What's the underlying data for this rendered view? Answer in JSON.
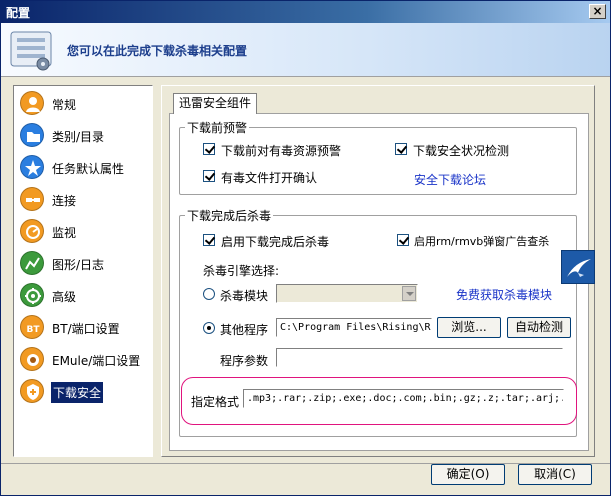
{
  "window": {
    "title": "配置",
    "close_label": "×"
  },
  "banner": {
    "text": "您可以在此完成下载杀毒相关配置"
  },
  "sidebar": {
    "items": [
      {
        "label": "常规",
        "icon": "person-icon",
        "color": "#f29a22"
      },
      {
        "label": "类别/目录",
        "icon": "folder-icon",
        "color": "#2a7ee0"
      },
      {
        "label": "任务默认属性",
        "icon": "star-icon",
        "color": "#2a7ee0"
      },
      {
        "label": "连接",
        "icon": "connection-icon",
        "color": "#f29a22"
      },
      {
        "label": "监视",
        "icon": "monitor-icon",
        "color": "#f29a22"
      },
      {
        "label": "图形/日志",
        "icon": "graph-icon",
        "color": "#3c9a3c"
      },
      {
        "label": "高级",
        "icon": "gear-icon",
        "color": "#3c9a3c"
      },
      {
        "label": "BT/端口设置",
        "icon": "bt-icon",
        "color": "#f29a22"
      },
      {
        "label": "EMule/端口设置",
        "icon": "emule-icon",
        "color": "#f29a22"
      },
      {
        "label": "下载安全",
        "icon": "shield-plus-icon",
        "color": "#f29a22"
      }
    ],
    "selected_index": 9
  },
  "tab": {
    "label": "迅雷安全组件"
  },
  "pre_download": {
    "legend": "下载前预警",
    "warn_toxic_label": "下载前对有毒资源预警",
    "warn_toxic_checked": true,
    "security_check_label": "下载安全状况检测",
    "security_check_checked": true,
    "confirm_open_label": "有毒文件打开确认",
    "confirm_open_checked": true,
    "forum_link": "安全下载论坛"
  },
  "post_download": {
    "legend": "下载完成后杀毒",
    "enable_scan_label": "启用下载完成后杀毒",
    "enable_scan_checked": true,
    "enable_rm_label": "启用rm/rmvb弹窗广告查杀",
    "enable_rm_checked": true,
    "engine_label": "杀毒引擎选择:",
    "module_label": "杀毒模块",
    "module_selected": false,
    "module_value": "",
    "free_link": "免费获取杀毒模块",
    "other_label": "其他程序",
    "other_selected": true,
    "other_path": "C:\\Program Files\\Rising\\R",
    "browse_label": "浏览...",
    "auto_detect_label": "自动检测",
    "params_label": "程序参数",
    "params_value": "",
    "format_label": "指定格式",
    "format_value": ".mp3;.rar;.zip;.exe;.doc;.com;.bin;.gz;.z;.tar;.arj;."
  },
  "footer": {
    "ok_label": "确定(O)",
    "cancel_label": "取消(C)"
  },
  "colors": {
    "accent": "#0a246a",
    "link": "#1a34c8",
    "highlight": "#e0147e"
  }
}
